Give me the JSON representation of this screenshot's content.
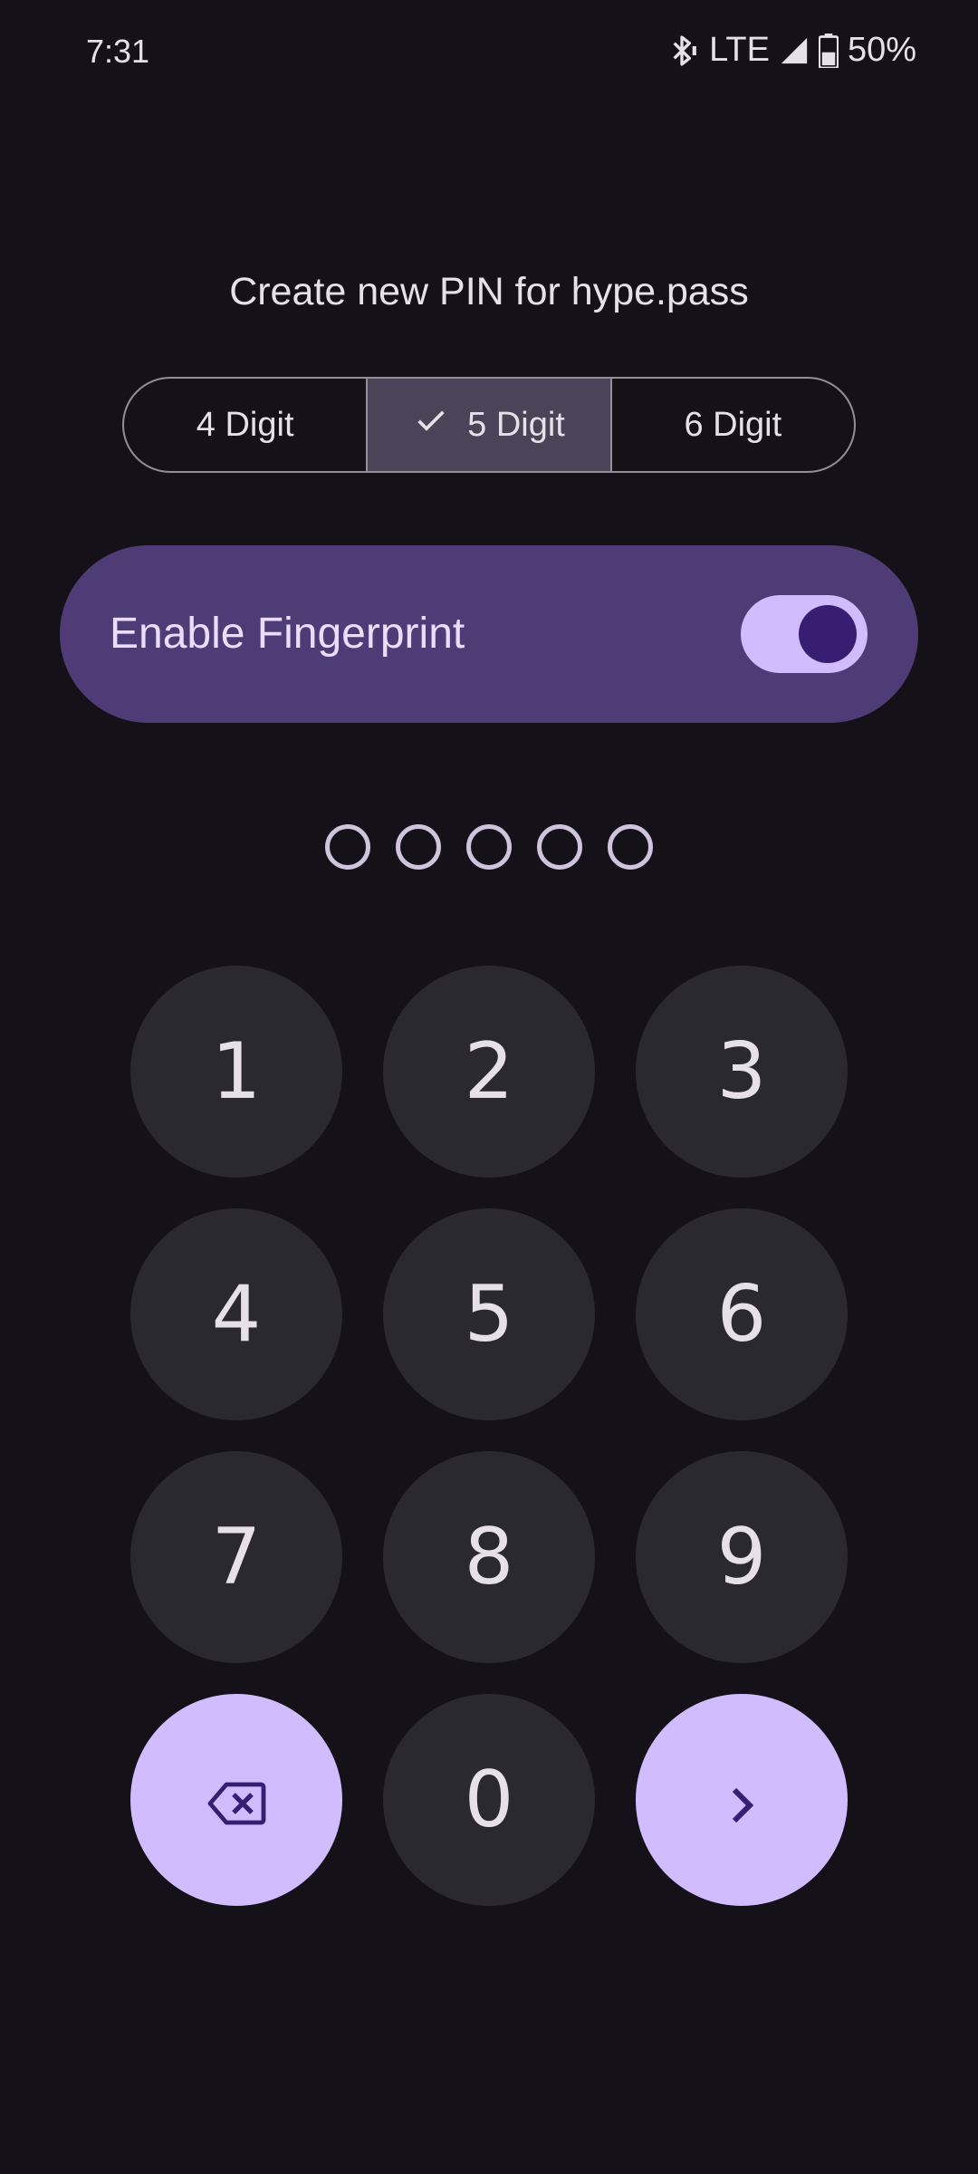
{
  "status_bar": {
    "time": "7:31",
    "network": "LTE",
    "battery": "50%",
    "icons": [
      "bluetooth-icon",
      "signal-icon",
      "battery-icon"
    ]
  },
  "title": "Create new PIN for hype.pass",
  "pin_length_options": [
    {
      "label": "4 Digit",
      "selected": false
    },
    {
      "label": "5 Digit",
      "selected": true
    },
    {
      "label": "6 Digit",
      "selected": false
    }
  ],
  "fingerprint": {
    "label": "Enable Fingerprint",
    "enabled": true
  },
  "pin": {
    "length": 5,
    "entered": 0
  },
  "keypad": {
    "keys": [
      "1",
      "2",
      "3",
      "4",
      "5",
      "6",
      "7",
      "8",
      "9"
    ],
    "zero": "0",
    "backspace_icon": "backspace-icon",
    "next_icon": "chevron-right-icon"
  },
  "colors": {
    "background": "#141218",
    "accent": "#D0BCFF",
    "card": "#4F3B75",
    "key_bg": "#2B2930"
  }
}
